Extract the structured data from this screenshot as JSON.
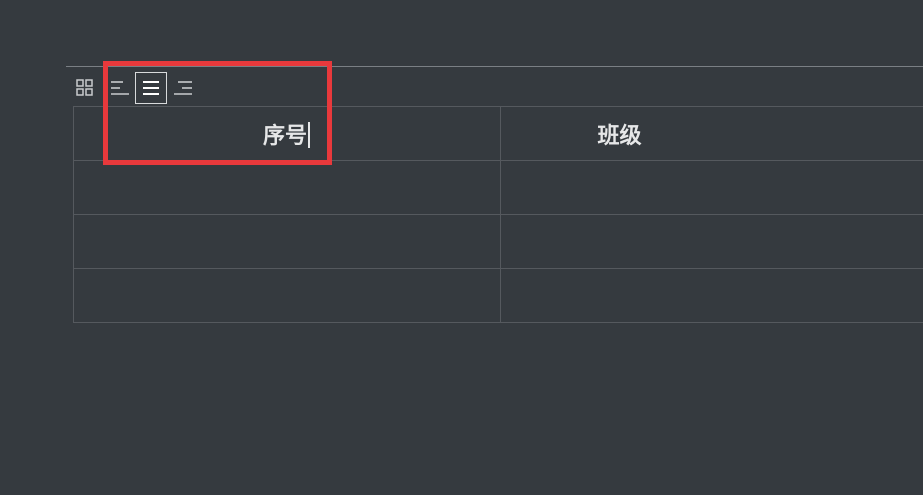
{
  "toolbar": {
    "icons": [
      "grid-icon",
      "align-left-icon",
      "align-center-icon",
      "align-right-icon"
    ],
    "active": "align-center-icon"
  },
  "table": {
    "headers": [
      "序号",
      "班级"
    ],
    "rows": [
      [
        "",
        ""
      ],
      [
        "",
        ""
      ],
      [
        "",
        ""
      ]
    ]
  },
  "colors": {
    "background": "#353a3f",
    "grid_line": "#55595e",
    "text": "#e6e7e8",
    "highlight": "#e8393c"
  }
}
